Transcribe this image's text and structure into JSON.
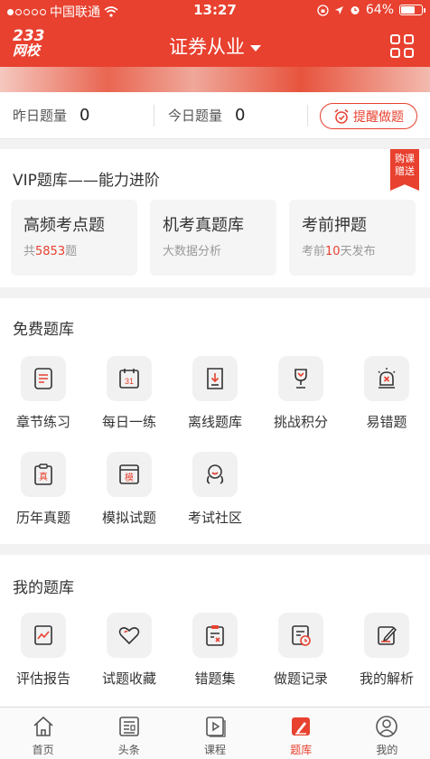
{
  "status": {
    "carrier": "中国联通",
    "time": "13:27",
    "battery": "64%"
  },
  "header": {
    "logo_line1": "233",
    "logo_line2": "网校",
    "title": "证券从业"
  },
  "counts": {
    "yesterday_label": "昨日题量",
    "yesterday_value": "0",
    "today_label": "今日题量",
    "today_value": "0",
    "remind_label": "提醒做题"
  },
  "vip": {
    "title": "VIP题库——能力进阶",
    "ribbon_line1": "购课",
    "ribbon_line2": "赠送",
    "cards": [
      {
        "title": "高频考点题",
        "sub_prefix": "共",
        "sub_highlight": "5853",
        "sub_suffix": "题"
      },
      {
        "title": "机考真题库",
        "sub_prefix": "大数据分析",
        "sub_highlight": "",
        "sub_suffix": ""
      },
      {
        "title": "考前押题",
        "sub_prefix": "考前",
        "sub_highlight": "10",
        "sub_suffix": "天发布"
      }
    ]
  },
  "free": {
    "title": "免费题库",
    "items": [
      {
        "label": "章节练习",
        "icon": "list-doc-icon"
      },
      {
        "label": "每日一练",
        "icon": "calendar-31-icon"
      },
      {
        "label": "离线题库",
        "icon": "download-doc-icon"
      },
      {
        "label": "挑战积分",
        "icon": "trophy-icon"
      },
      {
        "label": "易错题",
        "icon": "alarm-light-icon"
      },
      {
        "label": "历年真题",
        "icon": "clipboard-zhen-icon"
      },
      {
        "label": "模拟试题",
        "icon": "window-mo-icon"
      },
      {
        "label": "考试社区",
        "icon": "community-face-icon"
      }
    ]
  },
  "mine": {
    "title": "我的题库",
    "items": [
      {
        "label": "评估报告",
        "icon": "report-chart-icon"
      },
      {
        "label": "试题收藏",
        "icon": "heart-icon"
      },
      {
        "label": "错题集",
        "icon": "wrong-clipboard-icon"
      },
      {
        "label": "做题记录",
        "icon": "record-clock-icon"
      },
      {
        "label": "我的解析",
        "icon": "edit-note-icon"
      }
    ]
  },
  "tabs": [
    {
      "label": "首页",
      "icon": "home-icon"
    },
    {
      "label": "头条",
      "icon": "news-icon"
    },
    {
      "label": "课程",
      "icon": "play-course-icon"
    },
    {
      "label": "题库",
      "icon": "question-bank-icon"
    },
    {
      "label": "我的",
      "icon": "profile-icon"
    }
  ],
  "colors": {
    "accent": "#e8412f",
    "text": "#333333",
    "muted": "#999999"
  }
}
